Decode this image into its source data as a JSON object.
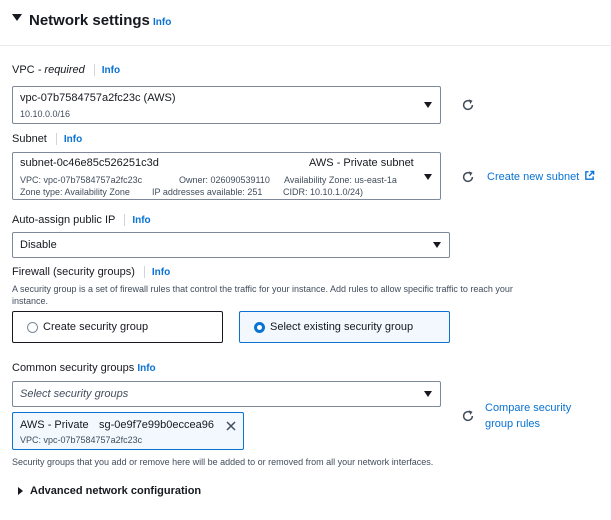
{
  "section": {
    "title": "Network settings",
    "info": "Info"
  },
  "vpc": {
    "label": "VPC",
    "required": "- required",
    "info": "Info",
    "value": "vpc-07b7584757a2fc23c (AWS)",
    "cidr": "10.10.0.0/16"
  },
  "subnet": {
    "label": "Subnet",
    "info": "Info",
    "id": "subnet-0c46e85c526251c3d",
    "name": "AWS - Private subnet",
    "vpc": "VPC: vpc-07b7584757a2fc23c",
    "owner": "Owner: 026090539110",
    "az": "Availability Zone: us-east-1a",
    "zone_type": "Zone type: Availability Zone",
    "ips": "IP addresses available: 251",
    "cidr": "CIDR: 10.10.1.0/24)",
    "create_link": "Create new subnet"
  },
  "public_ip": {
    "label": "Auto-assign public IP",
    "info": "Info",
    "value": "Disable"
  },
  "firewall": {
    "label": "Firewall (security groups)",
    "info": "Info",
    "description_line1": "A security group is a set of firewall rules that control the traffic for your instance. Add rules to allow specific traffic to reach your",
    "description_line2": "instance.",
    "options": [
      {
        "label": "Create security group",
        "selected": false
      },
      {
        "label": "Select existing security group",
        "selected": true
      }
    ]
  },
  "common_groups": {
    "label": "Common security groups",
    "info": "Info",
    "placeholder": "Select security groups",
    "token_name": "AWS - Private",
    "token_id": "sg-0e9f7e99b0eccea96",
    "token_vpc": "VPC: vpc-07b7584757a2fc23c",
    "compare_line1": "Compare security",
    "compare_line2": "group rules",
    "note": "Security groups that you add or remove here will be added to or removed from all your network interfaces."
  },
  "advanced": {
    "label": "Advanced network configuration"
  },
  "colors": {
    "link": "#0972d3",
    "text": "#16191f",
    "border": "#7d8998",
    "selected_bg": "#f2f8fd"
  },
  "icons": [
    "caret-down-icon",
    "refresh-icon",
    "external-link-icon",
    "close-icon",
    "caret-right-icon"
  ]
}
